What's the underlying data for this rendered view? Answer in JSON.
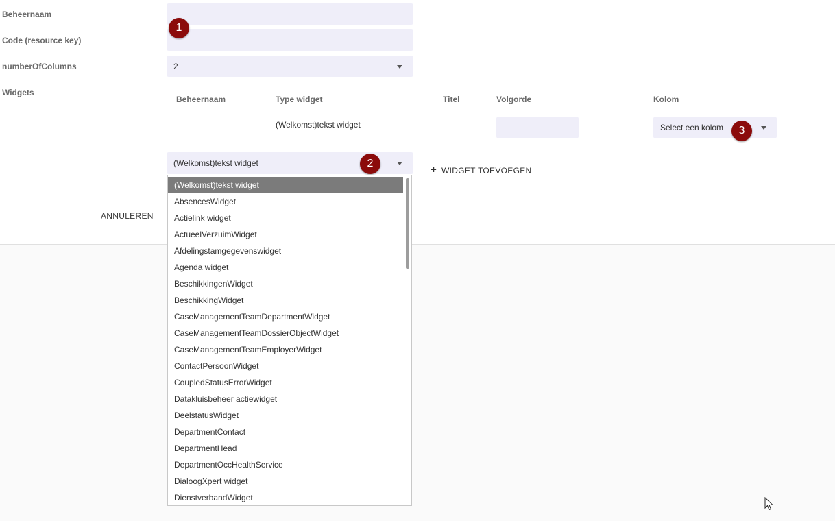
{
  "form": {
    "beheernaam_label": "Beheernaam",
    "code_label": "Code (resource key)",
    "columns_label": "numberOfColumns",
    "columns_value": "2",
    "widgets_label": "Widgets"
  },
  "table": {
    "headers": [
      "Beheernaam",
      "Type widget",
      "Titel",
      "Volgorde",
      "Kolom"
    ],
    "row": {
      "type_widget": "(Welkomst)tekst widget",
      "kolom_placeholder": "Select een kolom"
    }
  },
  "widget_select": {
    "value": "(Welkomst)tekst widget",
    "add_button": "WIDGET TOEVOEGEN",
    "options": [
      "(Welkomst)tekst widget",
      "AbsencesWidget",
      "Actielink widget",
      "ActueelVerzuimWidget",
      "Afdelingstamgegevenswidget",
      "Agenda widget",
      "BeschikkingenWidget",
      "BeschikkingWidget",
      "CaseManagementTeamDepartmentWidget",
      "CaseManagementTeamDossierObjectWidget",
      "CaseManagementTeamEmployerWidget",
      "ContactPersoonWidget",
      "CoupledStatusErrorWidget",
      "Datakluisbeheer actiewidget",
      "DeelstatusWidget",
      "DepartmentContact",
      "DepartmentHead",
      "DepartmentOccHealthService",
      "DialoogXpert widget",
      "DienstverbandWidget"
    ]
  },
  "actions": {
    "cancel": "ANNULEREN"
  },
  "badges": [
    "1",
    "2",
    "3"
  ],
  "colors": {
    "badge": "#8b0b0b",
    "input_bg": "#efeef9",
    "selected_option": "#7b7b7b"
  }
}
